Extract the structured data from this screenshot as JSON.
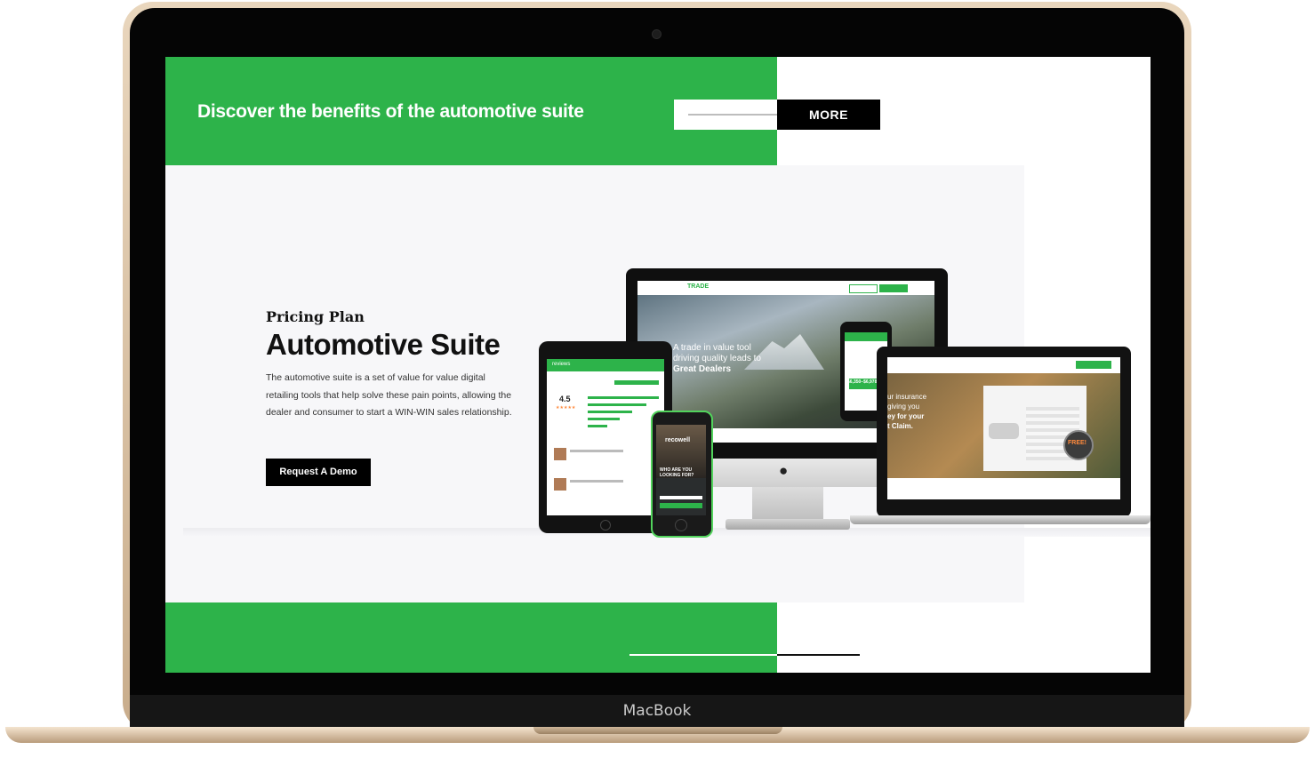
{
  "banner": {
    "title": "Discover the benefits of the automotive suite",
    "more_label": "MORE"
  },
  "hero": {
    "eyebrow": "Pricing Plan",
    "title": "Automotive Suite",
    "description": "The automotive suite is a set of value for value digital retailing tools that help solve these pain points, allowing the dealer and consumer to start a WIN-WIN sales relationship.",
    "cta_label": "Request A Demo"
  },
  "device": {
    "label": "MacBook"
  },
  "mockups": {
    "imac_brand": "TRADE",
    "imac_headline_1": "A trade in value tool",
    "imac_headline_2": "driving quality leads to",
    "imac_headline_3": "Great Dealers",
    "imac_price": "$6,350–$6,978",
    "phone_brand": "recowell",
    "phone_tagline": "WHO ARE YOU LOOKING FOR?",
    "tablet_brand": "reviews",
    "tablet_rating": "4.5",
    "laptop_text_1": "ur insurance",
    "laptop_text_2": "giving you",
    "laptop_text_3": "ey for your",
    "laptop_text_4": "t Claim.",
    "laptop_badge": "FREE!"
  },
  "colors": {
    "brand_green": "#2db34a",
    "black": "#000000",
    "hero_bg": "#f7f7f9"
  }
}
